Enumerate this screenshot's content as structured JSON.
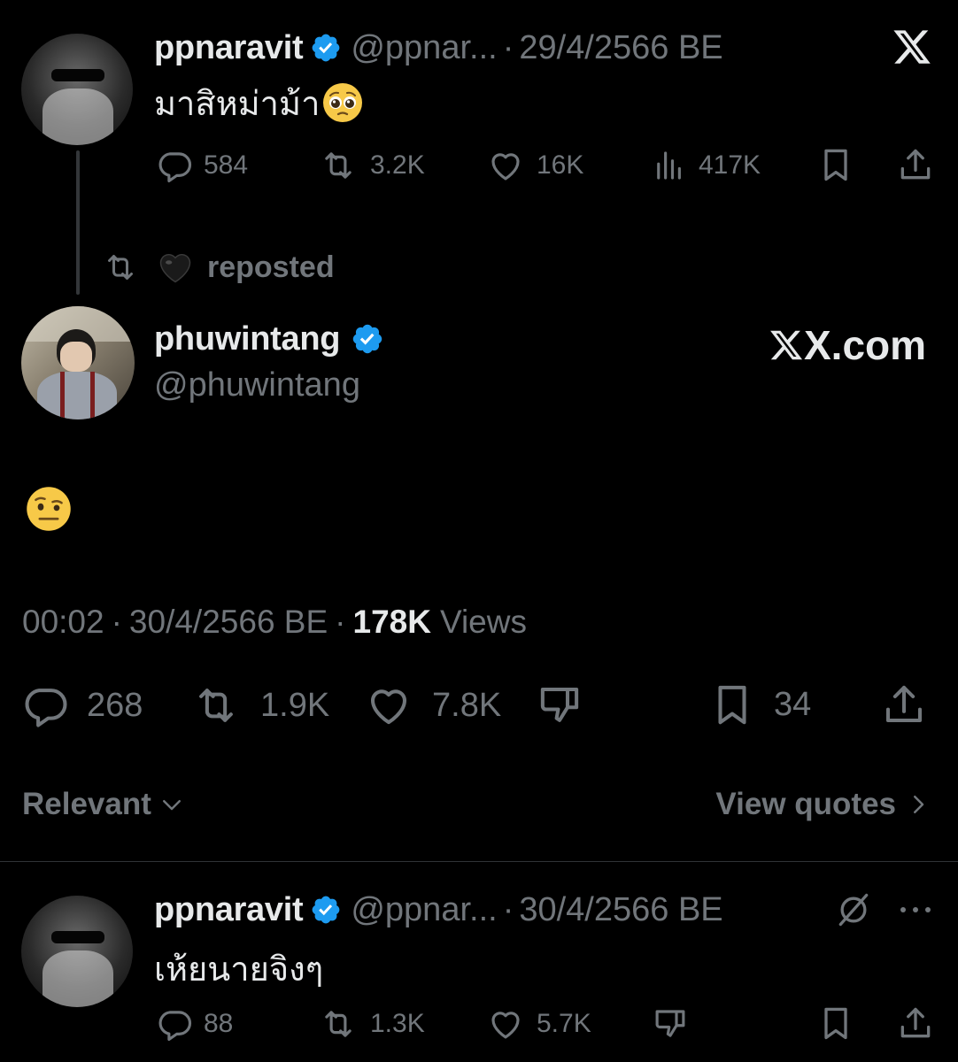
{
  "top_tweet": {
    "display_name": "ppnaravit",
    "handle": "@ppnar...",
    "separator": "·",
    "date": "29/4/2566 BE",
    "text": "มาสิหม่าม้า",
    "emoji": "pleading-face",
    "stats": {
      "replies": "584",
      "reposts": "3.2K",
      "likes": "16K",
      "views": "417K"
    }
  },
  "repost_bar": {
    "emoji": "black-heart",
    "label": "reposted"
  },
  "main_tweet": {
    "display_name": "phuwintang",
    "handle": "@phuwintang",
    "brand": "X.com",
    "emoji": "face-with-raised-eyebrow",
    "time": "00:02",
    "separator1": "·",
    "date": "30/4/2566 BE",
    "separator2": "·",
    "views_count": "178K",
    "views_label": "Views",
    "stats": {
      "replies": "268",
      "reposts": "1.9K",
      "likes": "7.8K",
      "bookmarks": "34"
    }
  },
  "filter": {
    "sort_label": "Relevant",
    "quotes_label": "View quotes"
  },
  "reply_tweet": {
    "display_name": "ppnaravit",
    "handle": "@ppnar...",
    "separator": "·",
    "date": "30/4/2566 BE",
    "text": "เห้ยนายจิงๆ",
    "stats": {
      "replies": "88",
      "reposts": "1.3K",
      "likes": "5.7K"
    }
  },
  "colors": {
    "background": "#000000",
    "text": "#e7e9ea",
    "muted": "#71767b",
    "verified": "#1d9bf0",
    "divider": "#2f3336"
  }
}
